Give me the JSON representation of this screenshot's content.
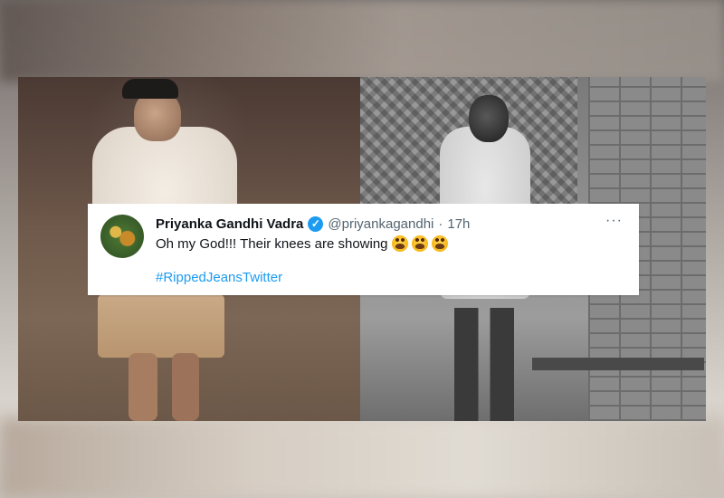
{
  "tweet": {
    "display_name": "Priyanka Gandhi Vadra",
    "handle": "@priyankagandhi",
    "separator": "·",
    "time": "17h",
    "more": "···",
    "text": "Oh my God!!! Their knees are showing",
    "emoji_icon": "face-screaming-in-fear-icon",
    "emoji_count": 3,
    "hashtag": "#RippedJeansTwitter",
    "verified_icon": "verified-badge-icon"
  },
  "colors": {
    "accent": "#1d9bf0",
    "text_primary": "#0f1419",
    "text_secondary": "#536471"
  }
}
